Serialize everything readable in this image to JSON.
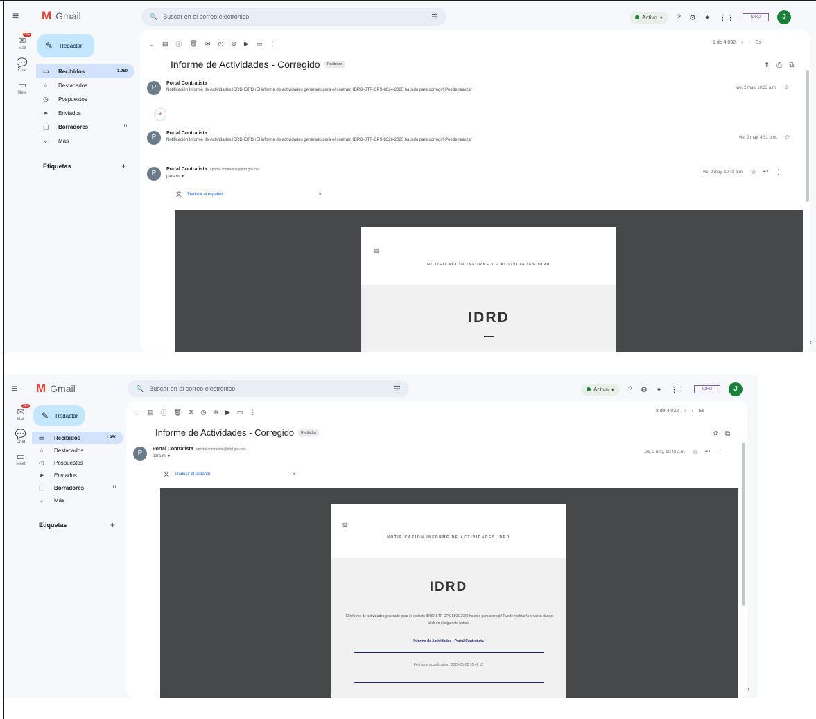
{
  "app": {
    "logo_letter": "M",
    "logo_text": "Gmail",
    "menu_icon": "menu-icon",
    "search_placeholder": "Buscar en el correo electrónico",
    "status_label": "Activo",
    "avatar_letter": "J",
    "brand_badge_text": "IDRD"
  },
  "rail": {
    "mail_label": "Mail",
    "mail_badge": "99+",
    "chat_label": "Chat",
    "meet_label": "Meet"
  },
  "compose_label": "Redactar",
  "nav": {
    "items": [
      {
        "label": "Recibidos",
        "count": "1.950"
      },
      {
        "label": "Destacados",
        "count": ""
      },
      {
        "label": "Pospuestos",
        "count": ""
      },
      {
        "label": "Enviados",
        "count": ""
      },
      {
        "label": "Borradores",
        "count": "11"
      },
      {
        "label": "Más",
        "count": ""
      }
    ],
    "labels_heading": "Etiquetas",
    "labels_add": "+"
  },
  "toolbar": {
    "pagination_1": "1 de 4.032",
    "pagination_2": "8 de 4.032",
    "lang_btn": "Es"
  },
  "thread": {
    "subject": "Informe de Actividades - Corregido",
    "tag": "Recibidos"
  },
  "messages": [
    {
      "sender": "Portal Contratista",
      "snippet": "Notificación Informe de Actividades IDRD IDRD ¡El informe de actividades generado para el contrato IDRD-STP-CPS-8624-2025 ha sido para corregir! Puede realizar",
      "date": "vie, 2 may, 10:33 a.m."
    },
    {
      "sender": "Portal Contratista",
      "snippet": "Notificación Informe de Actividades IDRD IDRD ¡El informe de actividades generado para el contrato IDRD-STP-CPS-8326-2025 ha sido para corregir! Puede realizar",
      "date": "vie, 2 may, 4:51 p.m."
    },
    {
      "sender": "Portal Contratista",
      "address": "<portal.contratista@idrd.gov.co>",
      "to": "para mí",
      "date": "vie, 2 may, 10:42 a.m."
    }
  ],
  "translate_label": "Traducir al español",
  "expand_count": "3",
  "email": {
    "notification_title": "NOTIFICACIÓN INFORME DE ACTIVIDADES IDRD",
    "heading": "IDRD",
    "body": "¡El informe de actividades generado para el contrato IDRD-STP-CPS-8806-2025 ha sido para corregir! Puede realizar la revisión dando click en el siguiente botón:",
    "link": "Informe de Actividades - Portal Contratista",
    "date_line": "Fecha de actualización: 2025-05-02 10:42:15"
  },
  "colors": {
    "accent_blue": "#c2e7ff",
    "nav_active": "#d3e3fd",
    "email_bg": "#46484a",
    "link": "#1a237e",
    "avatar_green": "#188038"
  }
}
